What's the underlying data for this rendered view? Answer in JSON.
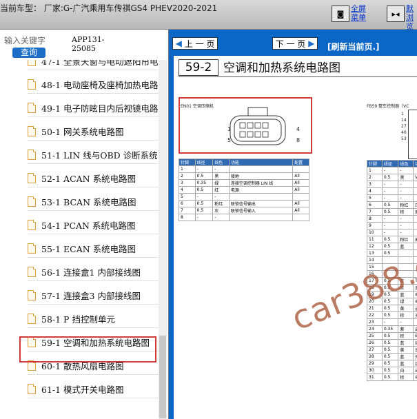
{
  "top_bar": {
    "car_model": "当前车型：  厂家:G-广汽乘用车传祺GS4 PHEV2020-2021",
    "fullscreen_label_1": "全屏",
    "fullscreen_label_2": "菜单",
    "rightbtn_label_1": "默",
    "rightbtn_label_2": "浏览"
  },
  "left_panel": {
    "search_placeholder": "输入关键字",
    "search_button": "查询",
    "app_code_1": "APP131-",
    "app_code_2": "25085",
    "items": [
      "47-1 全景天窗与电动遮阳帘电",
      "48-1 电动座椅及座椅加热电路",
      "49-1 电子防眩目内后视镜电路",
      "50-1 网关系统电路图",
      "51-1 LIN 线与OBD 诊断系统电",
      "52-1 ACAN 系统电路图",
      "53-1 BCAN 系统电路图",
      "54-1 PCAN 系统电路图",
      "55-1 ECAN 系统电路图",
      "56-1 连接盒1 内部接线图",
      "57-1 连接盒3 内部接线图",
      "58-1 P 挡控制单元",
      "59-1 空调和加热系统电路图",
      "60-1 散热风扇电路图",
      "61-1 模式开关电路图"
    ]
  },
  "right_panel": {
    "prev_button": "上 一 页",
    "next_button": "下 一 页",
    "refresh_link": "[刷新当前页.]",
    "page_number": "59-2",
    "page_title": "空调和加热系统电路图",
    "connector_left": "EN01  空调压缩机",
    "connector_right": "FB59  整车控制器（VC",
    "pin_labels": [
      "1",
      "5",
      "4",
      "8"
    ],
    "right_pin_labels": [
      "1",
      "14",
      "27",
      "40",
      "53"
    ],
    "table_headers": [
      "针脚",
      "线径",
      "线色",
      "功能",
      "配置"
    ],
    "left_table": [
      [
        "1",
        "-",
        "-",
        "",
        ""
      ],
      [
        "2",
        "0.5",
        "黑",
        "接地",
        "All"
      ],
      [
        "3",
        "0.35",
        "绿",
        "连接空调控制器 LIN 线",
        "All"
      ],
      [
        "4",
        "0.5",
        "红",
        "电源",
        "All"
      ],
      [
        "5",
        "-",
        "-",
        "",
        ""
      ],
      [
        "6",
        "0.5",
        "粉红",
        "联锁信号输出",
        "All"
      ],
      [
        "7",
        "0.5",
        "灰",
        "联锁信号输入",
        "All"
      ],
      [
        "8",
        "-",
        "-",
        "",
        ""
      ]
    ],
    "right_table": [
      [
        "1",
        "-",
        "-",
        ""
      ],
      [
        "2",
        "0.5",
        "黑",
        "VC"
      ],
      [
        "3",
        "-",
        "-",
        ""
      ],
      [
        "4",
        "-",
        "-",
        ""
      ],
      [
        "5",
        "-",
        "-",
        ""
      ],
      [
        "6",
        "0.5",
        "粉红",
        "压锁"
      ],
      [
        "7",
        "0.5",
        "棕",
        "刹"
      ],
      [
        "8",
        "-",
        "-",
        ""
      ],
      [
        "9",
        "-",
        "-",
        ""
      ],
      [
        "10",
        "-",
        "-",
        ""
      ],
      [
        "11",
        "0.5",
        "粉红",
        "高"
      ],
      [
        "12",
        "0.5",
        "蓝",
        ""
      ],
      [
        "13",
        "0.5",
        "",
        ""
      ],
      [
        "14",
        "",
        "",
        ""
      ],
      [
        "15",
        "",
        "",
        ""
      ],
      [
        "16",
        "",
        "",
        ""
      ],
      [
        "17",
        "0.5",
        "灰",
        "TG"
      ],
      [
        "18",
        "0.5",
        "灰",
        "真"
      ],
      [
        "19",
        "0.5",
        "蓝",
        "电"
      ],
      [
        "20",
        "0.5",
        "绿",
        "电"
      ],
      [
        "21",
        "0.5",
        "黄",
        "进"
      ],
      [
        "22",
        "0.5",
        "棕",
        "充"
      ],
      [
        "23",
        "-",
        "-",
        ""
      ],
      [
        "24",
        "0.35",
        "紫",
        "启"
      ],
      [
        "25",
        "0.5",
        "棕",
        "ER"
      ],
      [
        "26",
        "0.5",
        "蓝",
        "接"
      ],
      [
        "27",
        "0.5",
        "黄",
        "速"
      ],
      [
        "28",
        "0.5",
        "蓝",
        "外"
      ],
      [
        "29",
        "0.5",
        "蓝",
        "接"
      ],
      [
        "30",
        "0.5",
        "白",
        "出"
      ],
      [
        "31",
        "0.5",
        "棕",
        "电"
      ]
    ],
    "watermark": "car388.cc"
  }
}
